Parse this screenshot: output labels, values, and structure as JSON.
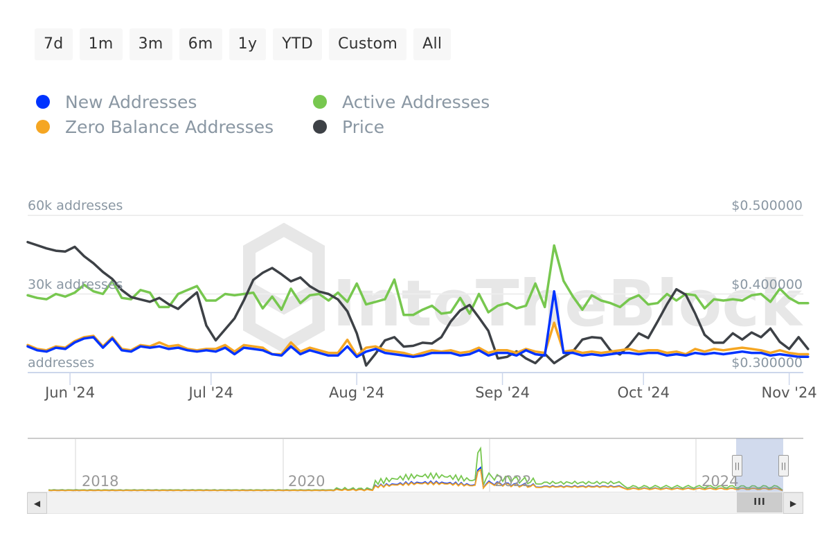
{
  "range_selector": {
    "buttons": [
      "7d",
      "1m",
      "3m",
      "6m",
      "1y",
      "YTD",
      "Custom",
      "All"
    ]
  },
  "legend": [
    {
      "name": "New Addresses",
      "color": "#0033ff"
    },
    {
      "name": "Active Addresses",
      "color": "#77c74f"
    },
    {
      "name": "Zero Balance Addresses",
      "color": "#f5a623"
    },
    {
      "name": "Price",
      "color": "#3d4146"
    }
  ],
  "watermark": "IntoTheBlock",
  "chart_data": {
    "type": "line",
    "title": "",
    "x_start": "2024-05-23",
    "x_step_days": 2,
    "x_end": "2024-11-04",
    "x_ticks": [
      "Jun '24",
      "Jul '24",
      "Aug '24",
      "Sep '24",
      "Oct '24",
      "Nov '24"
    ],
    "x_tick_dates": [
      "2024-06-01",
      "2024-07-01",
      "2024-08-01",
      "2024-09-01",
      "2024-10-01",
      "2024-11-01"
    ],
    "y_left": {
      "label_ticks": [
        "addresses",
        "30k addresses",
        "60k addresses"
      ],
      "tick_values": [
        0,
        30000,
        60000
      ],
      "range": [
        0,
        60000
      ]
    },
    "y_right": {
      "label_ticks": [
        "$0.300000",
        "$0.400000",
        "$0.500000"
      ],
      "tick_values": [
        0.3,
        0.4,
        0.5
      ],
      "range": [
        0.3,
        0.5
      ]
    },
    "grid": true,
    "legend_position": "top-left",
    "series": [
      {
        "name": "Active Addresses",
        "axis": "left",
        "color": "#77c74f",
        "values": [
          29500,
          28500,
          28000,
          30000,
          29000,
          30500,
          33500,
          31000,
          30000,
          35000,
          28500,
          28000,
          31500,
          30500,
          25000,
          25000,
          30000,
          31500,
          33000,
          27500,
          27500,
          30000,
          29500,
          30000,
          30500,
          24500,
          29000,
          24000,
          32000,
          26500,
          29500,
          30000,
          27500,
          30500,
          27000,
          34000,
          26000,
          27000,
          28000,
          35500,
          22000,
          22000,
          24000,
          25500,
          22500,
          23000,
          28500,
          22500,
          30000,
          23000,
          25500,
          26500,
          24500,
          25500,
          34000,
          25000,
          48500,
          35000,
          29000,
          24000,
          29500,
          27500,
          26500,
          25000,
          28000,
          29500,
          26000,
          26500,
          30000,
          27500,
          30000,
          29500,
          24500,
          28000,
          27500,
          28000,
          27500,
          29500,
          30000,
          27000,
          32000,
          28500,
          26500,
          26500
        ]
      },
      {
        "name": "Zero Balance Addresses",
        "axis": "left",
        "color": "#f5a623",
        "values": [
          10500,
          9000,
          8500,
          10000,
          9500,
          12000,
          13500,
          14000,
          10000,
          13500,
          9000,
          8500,
          10500,
          10000,
          11500,
          10000,
          10500,
          9000,
          8500,
          9000,
          9000,
          10500,
          8000,
          10500,
          10000,
          9500,
          7000,
          7000,
          11500,
          8000,
          9500,
          8500,
          7500,
          7500,
          12500,
          6500,
          9500,
          10000,
          8500,
          8000,
          7500,
          6500,
          7500,
          8500,
          8000,
          8500,
          7500,
          8000,
          9500,
          7500,
          8500,
          8500,
          7500,
          9000,
          8000,
          7500,
          19000,
          8000,
          8500,
          7500,
          8000,
          7500,
          8000,
          8500,
          9000,
          8000,
          8500,
          8500,
          7500,
          8000,
          7000,
          9000,
          8000,
          9000,
          8500,
          9000,
          9500,
          9000,
          8500,
          7500,
          8500,
          7500,
          7000,
          7000
        ]
      },
      {
        "name": "New Addresses",
        "axis": "left",
        "color": "#0033ff",
        "values": [
          10000,
          8500,
          8000,
          9500,
          9000,
          11500,
          13000,
          13500,
          9500,
          13000,
          8500,
          8000,
          10000,
          9500,
          10000,
          9000,
          9500,
          8500,
          8000,
          8500,
          8000,
          9500,
          7000,
          9500,
          9000,
          8500,
          7000,
          6500,
          10000,
          7000,
          8500,
          7500,
          6500,
          6500,
          10000,
          6000,
          8000,
          9000,
          7500,
          7000,
          6500,
          6000,
          6500,
          7500,
          7500,
          7500,
          6500,
          7000,
          8500,
          6500,
          7500,
          7500,
          6500,
          8500,
          7000,
          6500,
          31000,
          7500,
          7500,
          6500,
          7000,
          6500,
          7000,
          7500,
          7500,
          7000,
          7500,
          7500,
          6500,
          7000,
          6500,
          7500,
          7000,
          7500,
          7000,
          7500,
          8000,
          7500,
          7500,
          6500,
          7000,
          6500,
          6000,
          6000
        ]
      },
      {
        "name": "Price",
        "axis": "right",
        "color": "#3d4146",
        "values": [
          0.466,
          0.462,
          0.458,
          0.455,
          0.454,
          0.46,
          0.448,
          0.439,
          0.428,
          0.419,
          0.405,
          0.396,
          0.393,
          0.39,
          0.395,
          0.387,
          0.381,
          0.392,
          0.402,
          0.36,
          0.341,
          0.355,
          0.369,
          0.392,
          0.418,
          0.427,
          0.433,
          0.425,
          0.416,
          0.421,
          0.41,
          0.403,
          0.4,
          0.393,
          0.378,
          0.35,
          0.309,
          0.324,
          0.341,
          0.345,
          0.333,
          0.334,
          0.338,
          0.337,
          0.345,
          0.365,
          0.379,
          0.386,
          0.37,
          0.353,
          0.318,
          0.32,
          0.327,
          0.318,
          0.312,
          0.324,
          0.312,
          0.32,
          0.327,
          0.342,
          0.345,
          0.344,
          0.328,
          0.323,
          0.335,
          0.35,
          0.344,
          0.365,
          0.387,
          0.406,
          0.399,
          0.375,
          0.348,
          0.338,
          0.338,
          0.35,
          0.342,
          0.351,
          0.345,
          0.356,
          0.339,
          0.33,
          0.345,
          0.33
        ]
      }
    ]
  },
  "navigator": {
    "year_labels": [
      "2018",
      "2020",
      "2022",
      "2024"
    ],
    "scroll_thumb_glyph": "III",
    "handle_glyph": "||"
  }
}
